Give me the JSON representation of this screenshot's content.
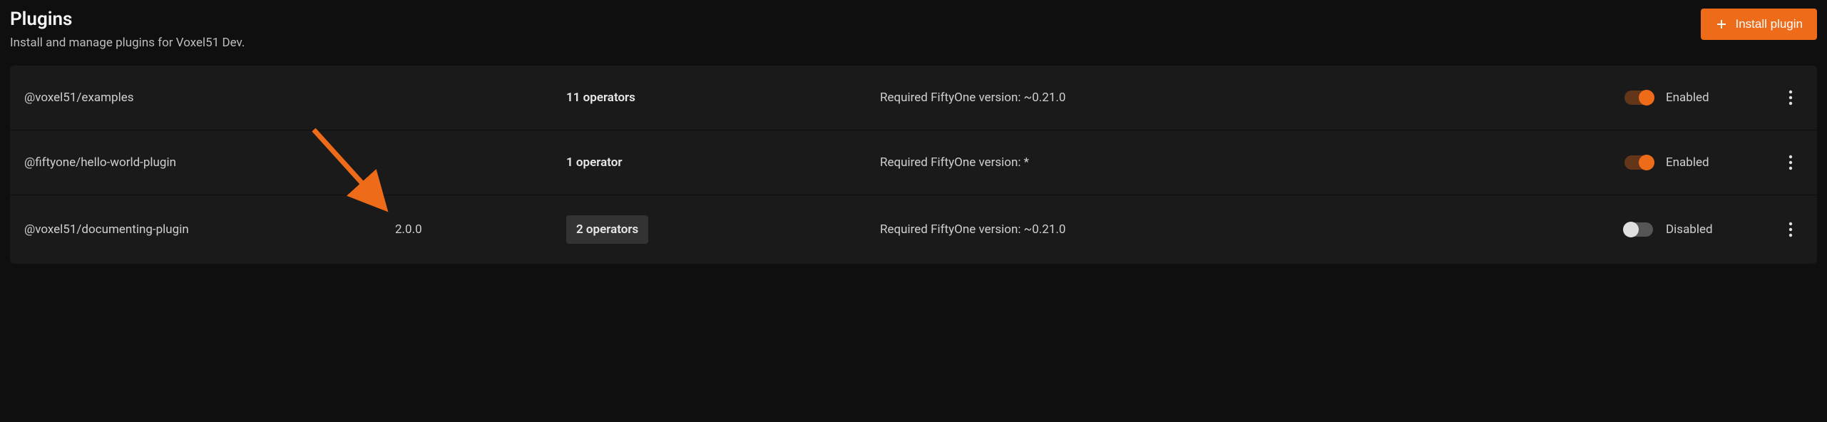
{
  "header": {
    "title": "Plugins",
    "subtitle": "Install and manage plugins for Voxel51 Dev.",
    "install_button": "Install plugin"
  },
  "required_version_prefix": "Required FiftyOne version: ",
  "status_labels": {
    "enabled": "Enabled",
    "disabled": "Disabled"
  },
  "plugins": [
    {
      "name": "@voxel51/examples",
      "version": "",
      "operators": "11 operators",
      "required_version": "~0.21.0",
      "enabled": true,
      "highlighted": false
    },
    {
      "name": "@fiftyone/hello-world-plugin",
      "version": "",
      "operators": "1 operator",
      "required_version": "*",
      "enabled": true,
      "highlighted": false
    },
    {
      "name": "@voxel51/documenting-plugin",
      "version": "2.0.0",
      "operators": "2 operators",
      "required_version": "~0.21.0",
      "enabled": false,
      "highlighted": true
    }
  ],
  "colors": {
    "accent": "#ee6b1a",
    "background": "#0f0f0f",
    "row_bg": "#1a1a1a"
  }
}
